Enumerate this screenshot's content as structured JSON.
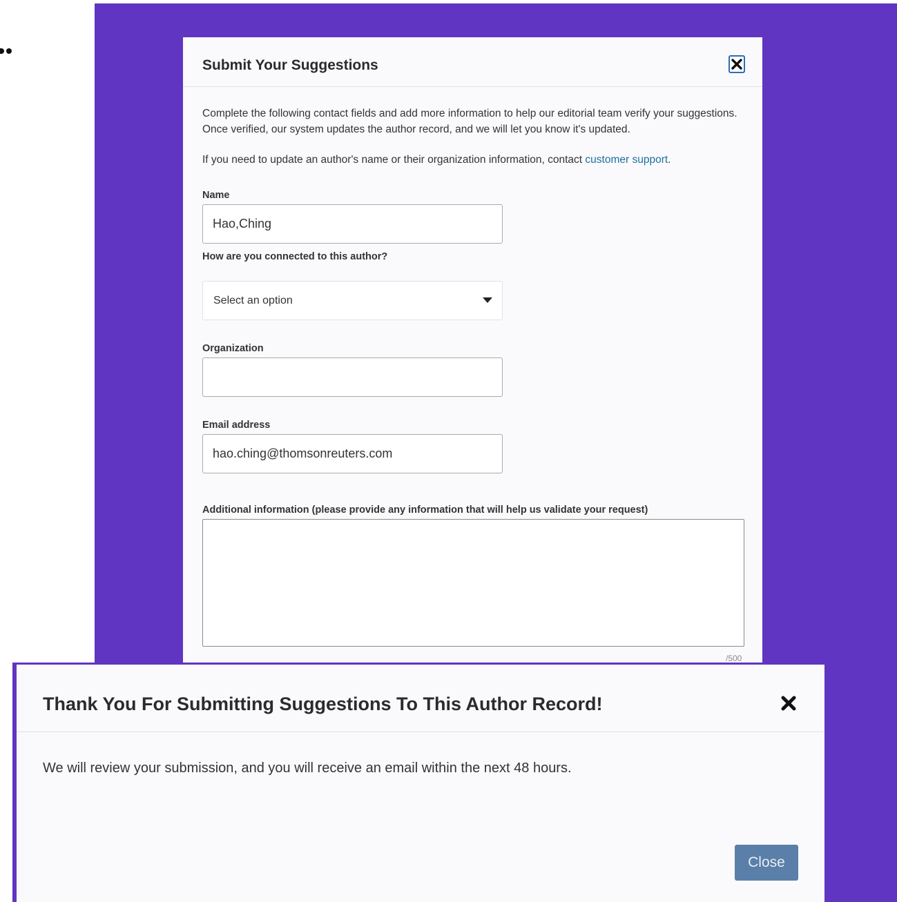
{
  "colors": {
    "backdrop": "#6035c2",
    "link": "#1f6f9a",
    "primary_button": "#5a7fa8",
    "focus_border": "#2a6eb8"
  },
  "suggest_modal": {
    "title": "Submit Your Suggestions",
    "close_icon": "close-x-icon",
    "intro": "Complete the following contact fields and add more information to help our editorial team verify your suggestions. Once verified, our system updates the author record, and we will let you know it's updated.",
    "support_prefix": "If you need to update an author's name or their organization information, contact ",
    "support_link": "customer support",
    "support_suffix": ".",
    "name_label": "Name",
    "name_value": "Hao,Ching",
    "connection_label": "How are you connected to this author?",
    "connection_value": "Select an option",
    "organization_label": "Organization",
    "organization_value": "",
    "email_label": "Email address",
    "email_value": "hao.ching@thomsonreuters.com",
    "additional_label": "Additional information (please provide any information that will help us validate your request)",
    "additional_value": "",
    "char_counter": "/500"
  },
  "thanks_modal": {
    "title": "Thank You For Submitting Suggestions To This Author Record!",
    "close_icon": "close-x-icon",
    "message": "We will review your submission, and you will receive an email within the next 48 hours.",
    "close_button": "Close"
  }
}
